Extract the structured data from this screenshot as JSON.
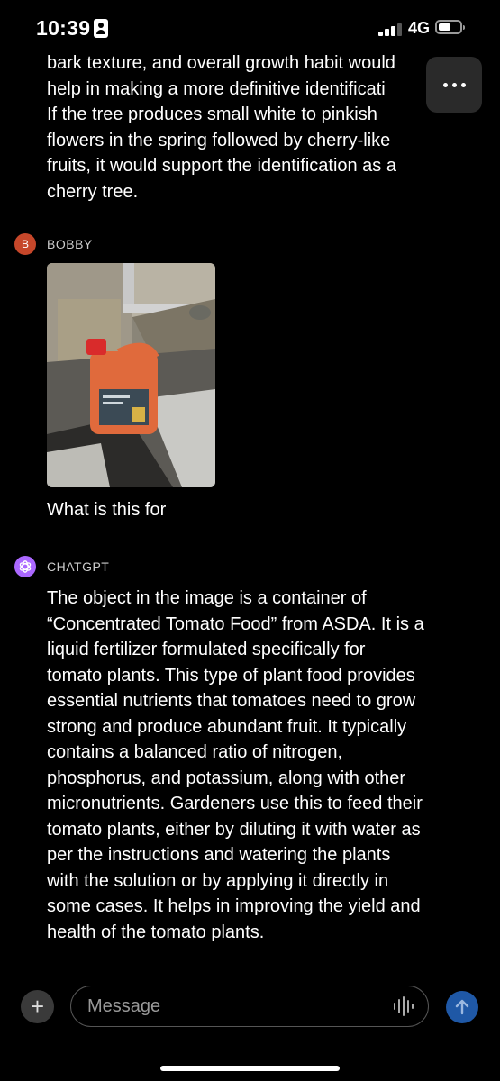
{
  "status_bar": {
    "time": "10:39",
    "network": "4G"
  },
  "previous_message_lines": [
    "bark texture, and overall growth habit would",
    "help in making a more definitive identificati",
    "If the tree produces small white to pinkish",
    "flowers in the spring followed by cherry-like",
    "fruits, it would support the identification as a",
    "cherry tree."
  ],
  "user": {
    "avatar_letter": "B",
    "name": "BOBBY",
    "message": "What is this for",
    "avatar_color": "#c6472a"
  },
  "bot": {
    "name": "CHATGPT",
    "avatar_color": "#ab68ff",
    "lines": [
      "The object in the image is a container of",
      "“Concentrated Tomato Food” from ASDA. It is a",
      "liquid fertilizer formulated specifically for",
      "tomato plants. This type of plant food provides",
      "essential nutrients that tomatoes need to grow",
      "strong and produce abundant fruit. It typically",
      "contains a balanced ratio of nitrogen,",
      "phosphorus, and potassium, along with other",
      "micronutrients. Gardeners use this to feed their",
      "tomato plants, either by diluting it with water as",
      "per the instructions and watering the plants",
      "with the solution or by applying it directly in",
      "some cases. It helps in improving the yield and",
      "health of the tomato plants."
    ]
  },
  "composer": {
    "placeholder": "Message",
    "plus_label": "+"
  },
  "icons": {
    "more": "more-horizontal-icon",
    "voice": "waveform-icon",
    "send": "arrow-up-icon",
    "plus": "plus-icon",
    "bot_avatar": "openai-logo-icon"
  },
  "colors": {
    "send_button": "#1f58a6",
    "background": "#000000"
  }
}
